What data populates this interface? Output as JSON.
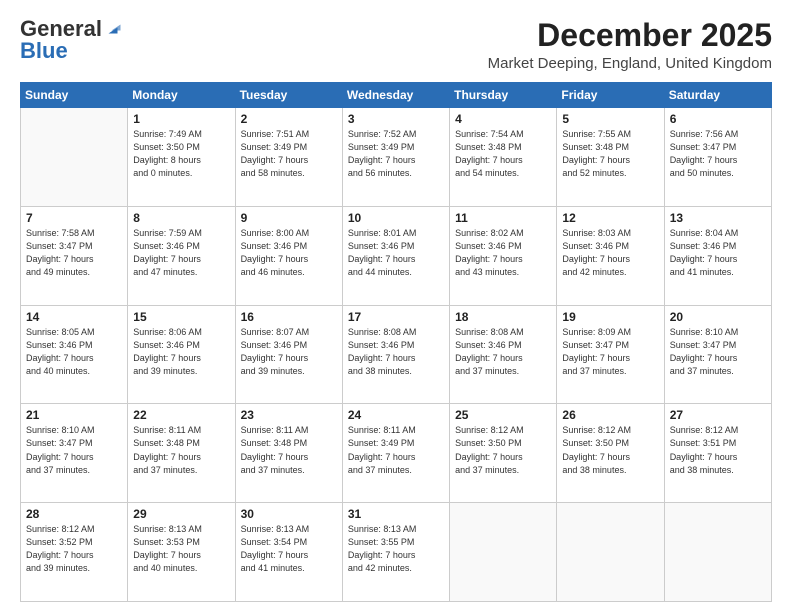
{
  "header": {
    "logo_general": "General",
    "logo_blue": "Blue",
    "main_title": "December 2025",
    "sub_title": "Market Deeping, England, United Kingdom"
  },
  "calendar": {
    "days_of_week": [
      "Sunday",
      "Monday",
      "Tuesday",
      "Wednesday",
      "Thursday",
      "Friday",
      "Saturday"
    ],
    "weeks": [
      [
        {
          "day": "",
          "info": ""
        },
        {
          "day": "1",
          "info": "Sunrise: 7:49 AM\nSunset: 3:50 PM\nDaylight: 8 hours\nand 0 minutes."
        },
        {
          "day": "2",
          "info": "Sunrise: 7:51 AM\nSunset: 3:49 PM\nDaylight: 7 hours\nand 58 minutes."
        },
        {
          "day": "3",
          "info": "Sunrise: 7:52 AM\nSunset: 3:49 PM\nDaylight: 7 hours\nand 56 minutes."
        },
        {
          "day": "4",
          "info": "Sunrise: 7:54 AM\nSunset: 3:48 PM\nDaylight: 7 hours\nand 54 minutes."
        },
        {
          "day": "5",
          "info": "Sunrise: 7:55 AM\nSunset: 3:48 PM\nDaylight: 7 hours\nand 52 minutes."
        },
        {
          "day": "6",
          "info": "Sunrise: 7:56 AM\nSunset: 3:47 PM\nDaylight: 7 hours\nand 50 minutes."
        }
      ],
      [
        {
          "day": "7",
          "info": "Sunrise: 7:58 AM\nSunset: 3:47 PM\nDaylight: 7 hours\nand 49 minutes."
        },
        {
          "day": "8",
          "info": "Sunrise: 7:59 AM\nSunset: 3:46 PM\nDaylight: 7 hours\nand 47 minutes."
        },
        {
          "day": "9",
          "info": "Sunrise: 8:00 AM\nSunset: 3:46 PM\nDaylight: 7 hours\nand 46 minutes."
        },
        {
          "day": "10",
          "info": "Sunrise: 8:01 AM\nSunset: 3:46 PM\nDaylight: 7 hours\nand 44 minutes."
        },
        {
          "day": "11",
          "info": "Sunrise: 8:02 AM\nSunset: 3:46 PM\nDaylight: 7 hours\nand 43 minutes."
        },
        {
          "day": "12",
          "info": "Sunrise: 8:03 AM\nSunset: 3:46 PM\nDaylight: 7 hours\nand 42 minutes."
        },
        {
          "day": "13",
          "info": "Sunrise: 8:04 AM\nSunset: 3:46 PM\nDaylight: 7 hours\nand 41 minutes."
        }
      ],
      [
        {
          "day": "14",
          "info": "Sunrise: 8:05 AM\nSunset: 3:46 PM\nDaylight: 7 hours\nand 40 minutes."
        },
        {
          "day": "15",
          "info": "Sunrise: 8:06 AM\nSunset: 3:46 PM\nDaylight: 7 hours\nand 39 minutes."
        },
        {
          "day": "16",
          "info": "Sunrise: 8:07 AM\nSunset: 3:46 PM\nDaylight: 7 hours\nand 39 minutes."
        },
        {
          "day": "17",
          "info": "Sunrise: 8:08 AM\nSunset: 3:46 PM\nDaylight: 7 hours\nand 38 minutes."
        },
        {
          "day": "18",
          "info": "Sunrise: 8:08 AM\nSunset: 3:46 PM\nDaylight: 7 hours\nand 37 minutes."
        },
        {
          "day": "19",
          "info": "Sunrise: 8:09 AM\nSunset: 3:47 PM\nDaylight: 7 hours\nand 37 minutes."
        },
        {
          "day": "20",
          "info": "Sunrise: 8:10 AM\nSunset: 3:47 PM\nDaylight: 7 hours\nand 37 minutes."
        }
      ],
      [
        {
          "day": "21",
          "info": "Sunrise: 8:10 AM\nSunset: 3:47 PM\nDaylight: 7 hours\nand 37 minutes."
        },
        {
          "day": "22",
          "info": "Sunrise: 8:11 AM\nSunset: 3:48 PM\nDaylight: 7 hours\nand 37 minutes."
        },
        {
          "day": "23",
          "info": "Sunrise: 8:11 AM\nSunset: 3:48 PM\nDaylight: 7 hours\nand 37 minutes."
        },
        {
          "day": "24",
          "info": "Sunrise: 8:11 AM\nSunset: 3:49 PM\nDaylight: 7 hours\nand 37 minutes."
        },
        {
          "day": "25",
          "info": "Sunrise: 8:12 AM\nSunset: 3:50 PM\nDaylight: 7 hours\nand 37 minutes."
        },
        {
          "day": "26",
          "info": "Sunrise: 8:12 AM\nSunset: 3:50 PM\nDaylight: 7 hours\nand 38 minutes."
        },
        {
          "day": "27",
          "info": "Sunrise: 8:12 AM\nSunset: 3:51 PM\nDaylight: 7 hours\nand 38 minutes."
        }
      ],
      [
        {
          "day": "28",
          "info": "Sunrise: 8:12 AM\nSunset: 3:52 PM\nDaylight: 7 hours\nand 39 minutes."
        },
        {
          "day": "29",
          "info": "Sunrise: 8:13 AM\nSunset: 3:53 PM\nDaylight: 7 hours\nand 40 minutes."
        },
        {
          "day": "30",
          "info": "Sunrise: 8:13 AM\nSunset: 3:54 PM\nDaylight: 7 hours\nand 41 minutes."
        },
        {
          "day": "31",
          "info": "Sunrise: 8:13 AM\nSunset: 3:55 PM\nDaylight: 7 hours\nand 42 minutes."
        },
        {
          "day": "",
          "info": ""
        },
        {
          "day": "",
          "info": ""
        },
        {
          "day": "",
          "info": ""
        }
      ]
    ]
  }
}
